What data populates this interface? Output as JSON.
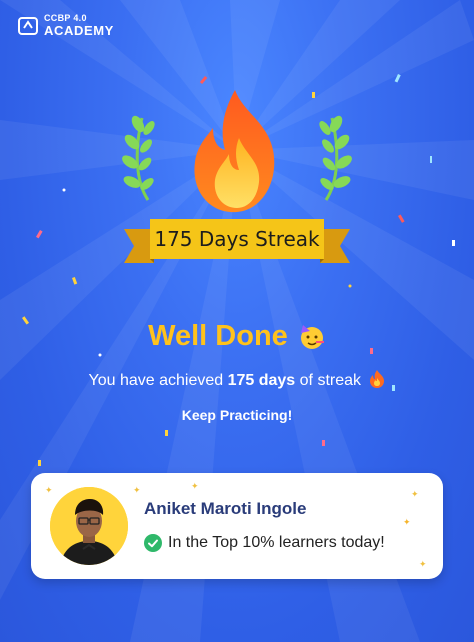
{
  "brand": {
    "line1": "CCBP 4.0",
    "line2": "ACADEMY"
  },
  "streak": {
    "label": "175 Days Streak"
  },
  "headline": {
    "text": "Well Done"
  },
  "message": {
    "prefix": "You have achieved ",
    "highlight": "175 days",
    "suffix": " of streak"
  },
  "cta_text": "Keep Practicing!",
  "user": {
    "name": "Aniket Maroti Ingole",
    "achievement": "In the Top 10% learners today!"
  },
  "colors": {
    "background": "#3b6ff2",
    "accent_yellow": "#ffc21c",
    "ribbon": "#f5c518",
    "success_green": "#2fb86a"
  },
  "icons": [
    "logo-icon",
    "fire-icon",
    "laurel-icon",
    "party-face-emoji",
    "fire-emoji",
    "check-circle-icon"
  ]
}
